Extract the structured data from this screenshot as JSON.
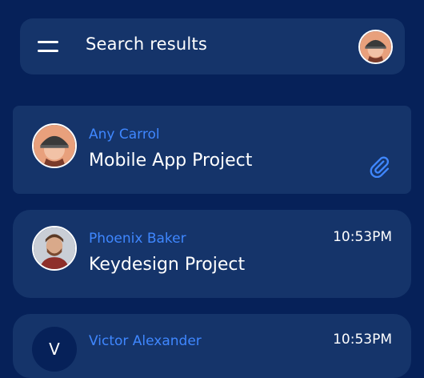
{
  "header": {
    "title": "Search results",
    "menu_icon": "hamburger-menu-icon",
    "avatar": "user-avatar"
  },
  "colors": {
    "background": "#062159",
    "card": "#15346A",
    "accent": "#3F87FF",
    "text": "#FFFFFF"
  },
  "messages": [
    {
      "sender": "Any Carrol",
      "subject": "Mobile App Project",
      "time": "",
      "avatar": "photo-avatar",
      "has_attachment": true,
      "attachment_icon": "paperclip-icon"
    },
    {
      "sender": "Phoenix Baker",
      "subject": "Keydesign Project",
      "time": "10:53PM",
      "avatar": "photo-avatar",
      "has_attachment": false
    },
    {
      "sender": "Victor Alexander",
      "subject": "",
      "time": "10:53PM",
      "avatar_initial": "V",
      "has_attachment": false
    }
  ]
}
